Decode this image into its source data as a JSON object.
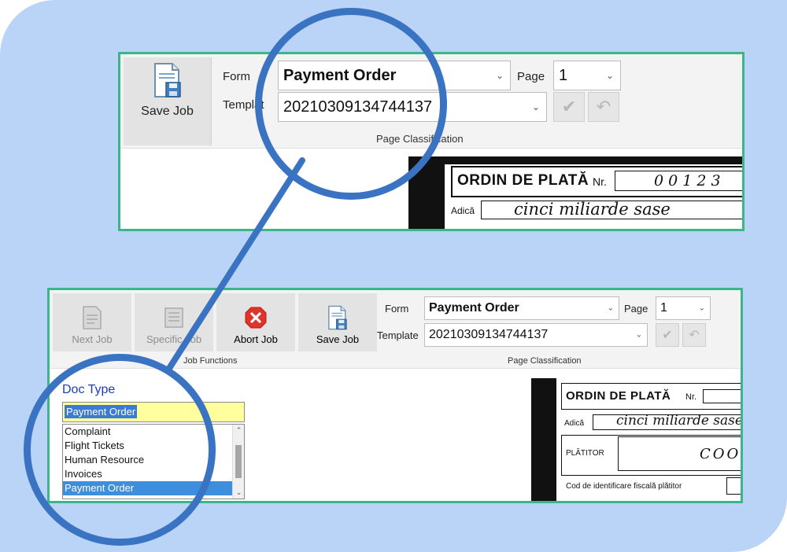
{
  "top_panel": {
    "save_label": "Save Job",
    "form_label": "Form",
    "form_value": "Payment Order",
    "page_label": "Page",
    "page_value": "1",
    "template_label": "Templat",
    "template_value": "20210309134744137",
    "group_caption": "Page Classification",
    "confirm_icon": "check-icon",
    "undo_icon": "undo-icon"
  },
  "bottom_panel": {
    "job_buttons": {
      "next": "Next Job",
      "specific": "Specific Job",
      "abort": "Abort Job",
      "save": "Save Job"
    },
    "job_group_caption": "Job Functions",
    "form_label": "Form",
    "form_value": "Payment Order",
    "page_label": "Page",
    "page_value": "1",
    "template_label": "Template",
    "template_value": "20210309134744137",
    "page_group_caption": "Page Classification",
    "doc_type": {
      "label": "Doc Type",
      "value": "Payment Order",
      "options": [
        "Complaint",
        "Flight Tickets",
        "Human Resource",
        "Invoices",
        "Payment Order"
      ],
      "selected": "Payment Order"
    }
  },
  "document_preview": {
    "title": "ORDIN DE PLATĂ",
    "nr_label": "Nr.",
    "number": "0 0 1 2 3",
    "adica_label": "Adică",
    "amount_words": "cinci miliarde sase",
    "platitor_label": "PLĂTITOR",
    "platitor_value": "COO",
    "fiscal_label": "Cod de identificare fiscală plătitor"
  },
  "colors": {
    "background": "#b9d4f7",
    "panel_border": "#3cb58a",
    "highlight_circle": "#3a73c2",
    "doctype_label": "#1a3fb5",
    "selection": "#3d8fdd",
    "input_highlight": "#ffff9e",
    "abort_red": "#e0342b"
  }
}
